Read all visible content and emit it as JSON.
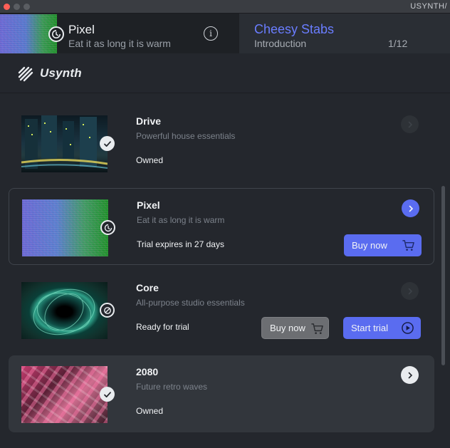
{
  "window": {
    "title": "USYNTH/"
  },
  "header": {
    "preset_name": "Pixel",
    "preset_tagline": "Eat it as long it is warm",
    "pack_title": "Cheesy Stabs",
    "pack_section": "Introduction",
    "pack_page": "1/12"
  },
  "brand": {
    "name": "Usynth"
  },
  "colors": {
    "accent": "#5a6cf0",
    "pack_title": "#6a7dff",
    "background": "#24272d"
  },
  "cards": [
    {
      "name": "Drive",
      "description": "Powerful house essentials",
      "status": "Owned",
      "badge_icon": "check-icon",
      "chevron_state": "dim"
    },
    {
      "name": "Pixel",
      "description": "Eat it as long it is warm",
      "status": "Trial expires in 27 days",
      "badge_icon": "trial-clock-icon",
      "chevron_state": "active",
      "buttons": {
        "buy_label": "Buy now"
      }
    },
    {
      "name": "Core",
      "description": "All-purpose studio essentials",
      "status": "Ready for trial",
      "badge_icon": "blocked-icon",
      "chevron_state": "dim",
      "buttons": {
        "buy_label": "Buy now",
        "trial_label": "Start trial"
      }
    },
    {
      "name": "2080",
      "description": "Future retro waves",
      "status": "Owned",
      "badge_icon": "check-icon",
      "chevron_state": "light"
    }
  ]
}
